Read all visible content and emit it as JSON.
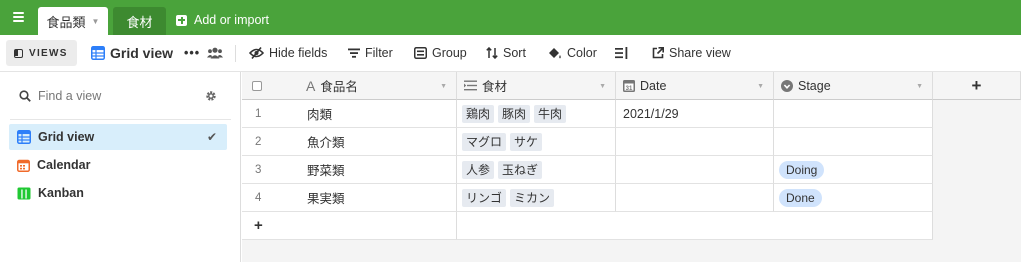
{
  "topbar": {
    "active_tab": "食品類",
    "inactive_tab": "食材",
    "add_import": "Add or import"
  },
  "toolbar": {
    "views": "VIEWS",
    "view_name": "Grid view",
    "hide_fields": "Hide fields",
    "filter": "Filter",
    "group": "Group",
    "sort": "Sort",
    "color": "Color",
    "share_view": "Share view"
  },
  "sidebar": {
    "search_placeholder": "Find a view",
    "items": [
      {
        "label": "Grid view",
        "icon": "grid-icon",
        "selected": true
      },
      {
        "label": "Calendar",
        "icon": "calendar-icon",
        "selected": false
      },
      {
        "label": "Kanban",
        "icon": "kanban-icon",
        "selected": false
      }
    ]
  },
  "table": {
    "columns": [
      "食品名",
      "食材",
      "Date",
      "Stage"
    ],
    "rows": [
      {
        "num": "1",
        "name": "肉類",
        "ingredients": [
          "鶏肉",
          "豚肉",
          "牛肉"
        ],
        "date": "2021/1/29",
        "stage": ""
      },
      {
        "num": "2",
        "name": "魚介類",
        "ingredients": [
          "マグロ",
          "サケ"
        ],
        "date": "",
        "stage": ""
      },
      {
        "num": "3",
        "name": "野菜類",
        "ingredients": [
          "人参",
          "玉ねぎ"
        ],
        "date": "",
        "stage": "Doing"
      },
      {
        "num": "4",
        "name": "果実類",
        "ingredients": [
          "リンゴ",
          "ミカン"
        ],
        "date": "",
        "stage": "Done"
      }
    ],
    "add_row": "+",
    "add_field": "+"
  },
  "colors": {
    "topbar": "#4aa33b",
    "selected_view": "#d8eefb",
    "stage_pill": "#d0e3fc",
    "grid_icon": "#2d7ff9",
    "calendar_icon": "#f06a2a",
    "kanban_icon": "#20c933"
  }
}
